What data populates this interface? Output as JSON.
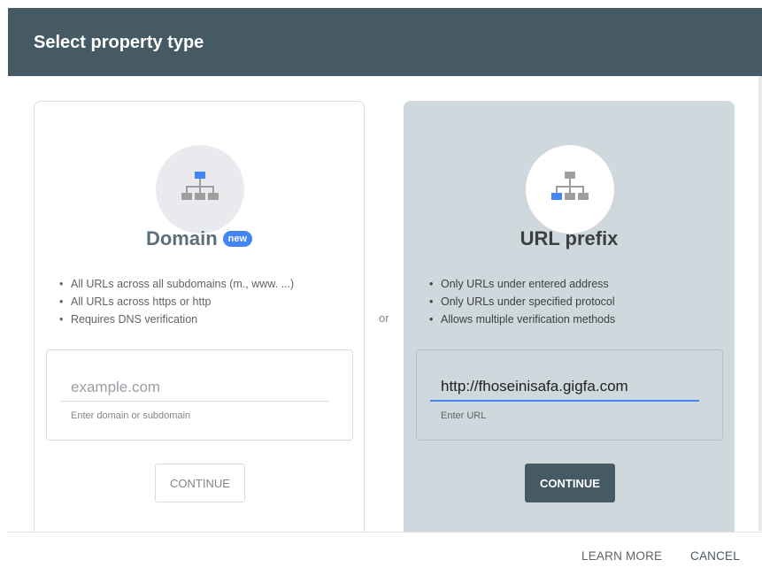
{
  "dialog": {
    "title": "Select property type"
  },
  "separator": {
    "or": "or"
  },
  "domain_card": {
    "title": "Domain",
    "badge": "new",
    "icon": "sitemap-icon",
    "bullets": [
      "All URLs across all subdomains (m., www. ...)",
      "All URLs across https or http",
      "Requires DNS verification"
    ],
    "input": {
      "value": "",
      "placeholder": "example.com",
      "hint": "Enter domain or subdomain"
    },
    "continue_label": "CONTINUE"
  },
  "url_card": {
    "title": "URL prefix",
    "icon": "sitemap-icon",
    "bullets": [
      "Only URLs under entered address",
      "Only URLs under specified protocol",
      "Allows multiple verification methods"
    ],
    "input": {
      "value": "http://fhoseinisafa.gigfa.com",
      "placeholder": "",
      "hint": "Enter URL"
    },
    "continue_label": "CONTINUE"
  },
  "footer": {
    "learn_more": "LEARN MORE",
    "cancel": "CANCEL"
  },
  "colors": {
    "header": "#455a64",
    "accent": "#4285f4",
    "selected_card": "#cfd8dc"
  }
}
